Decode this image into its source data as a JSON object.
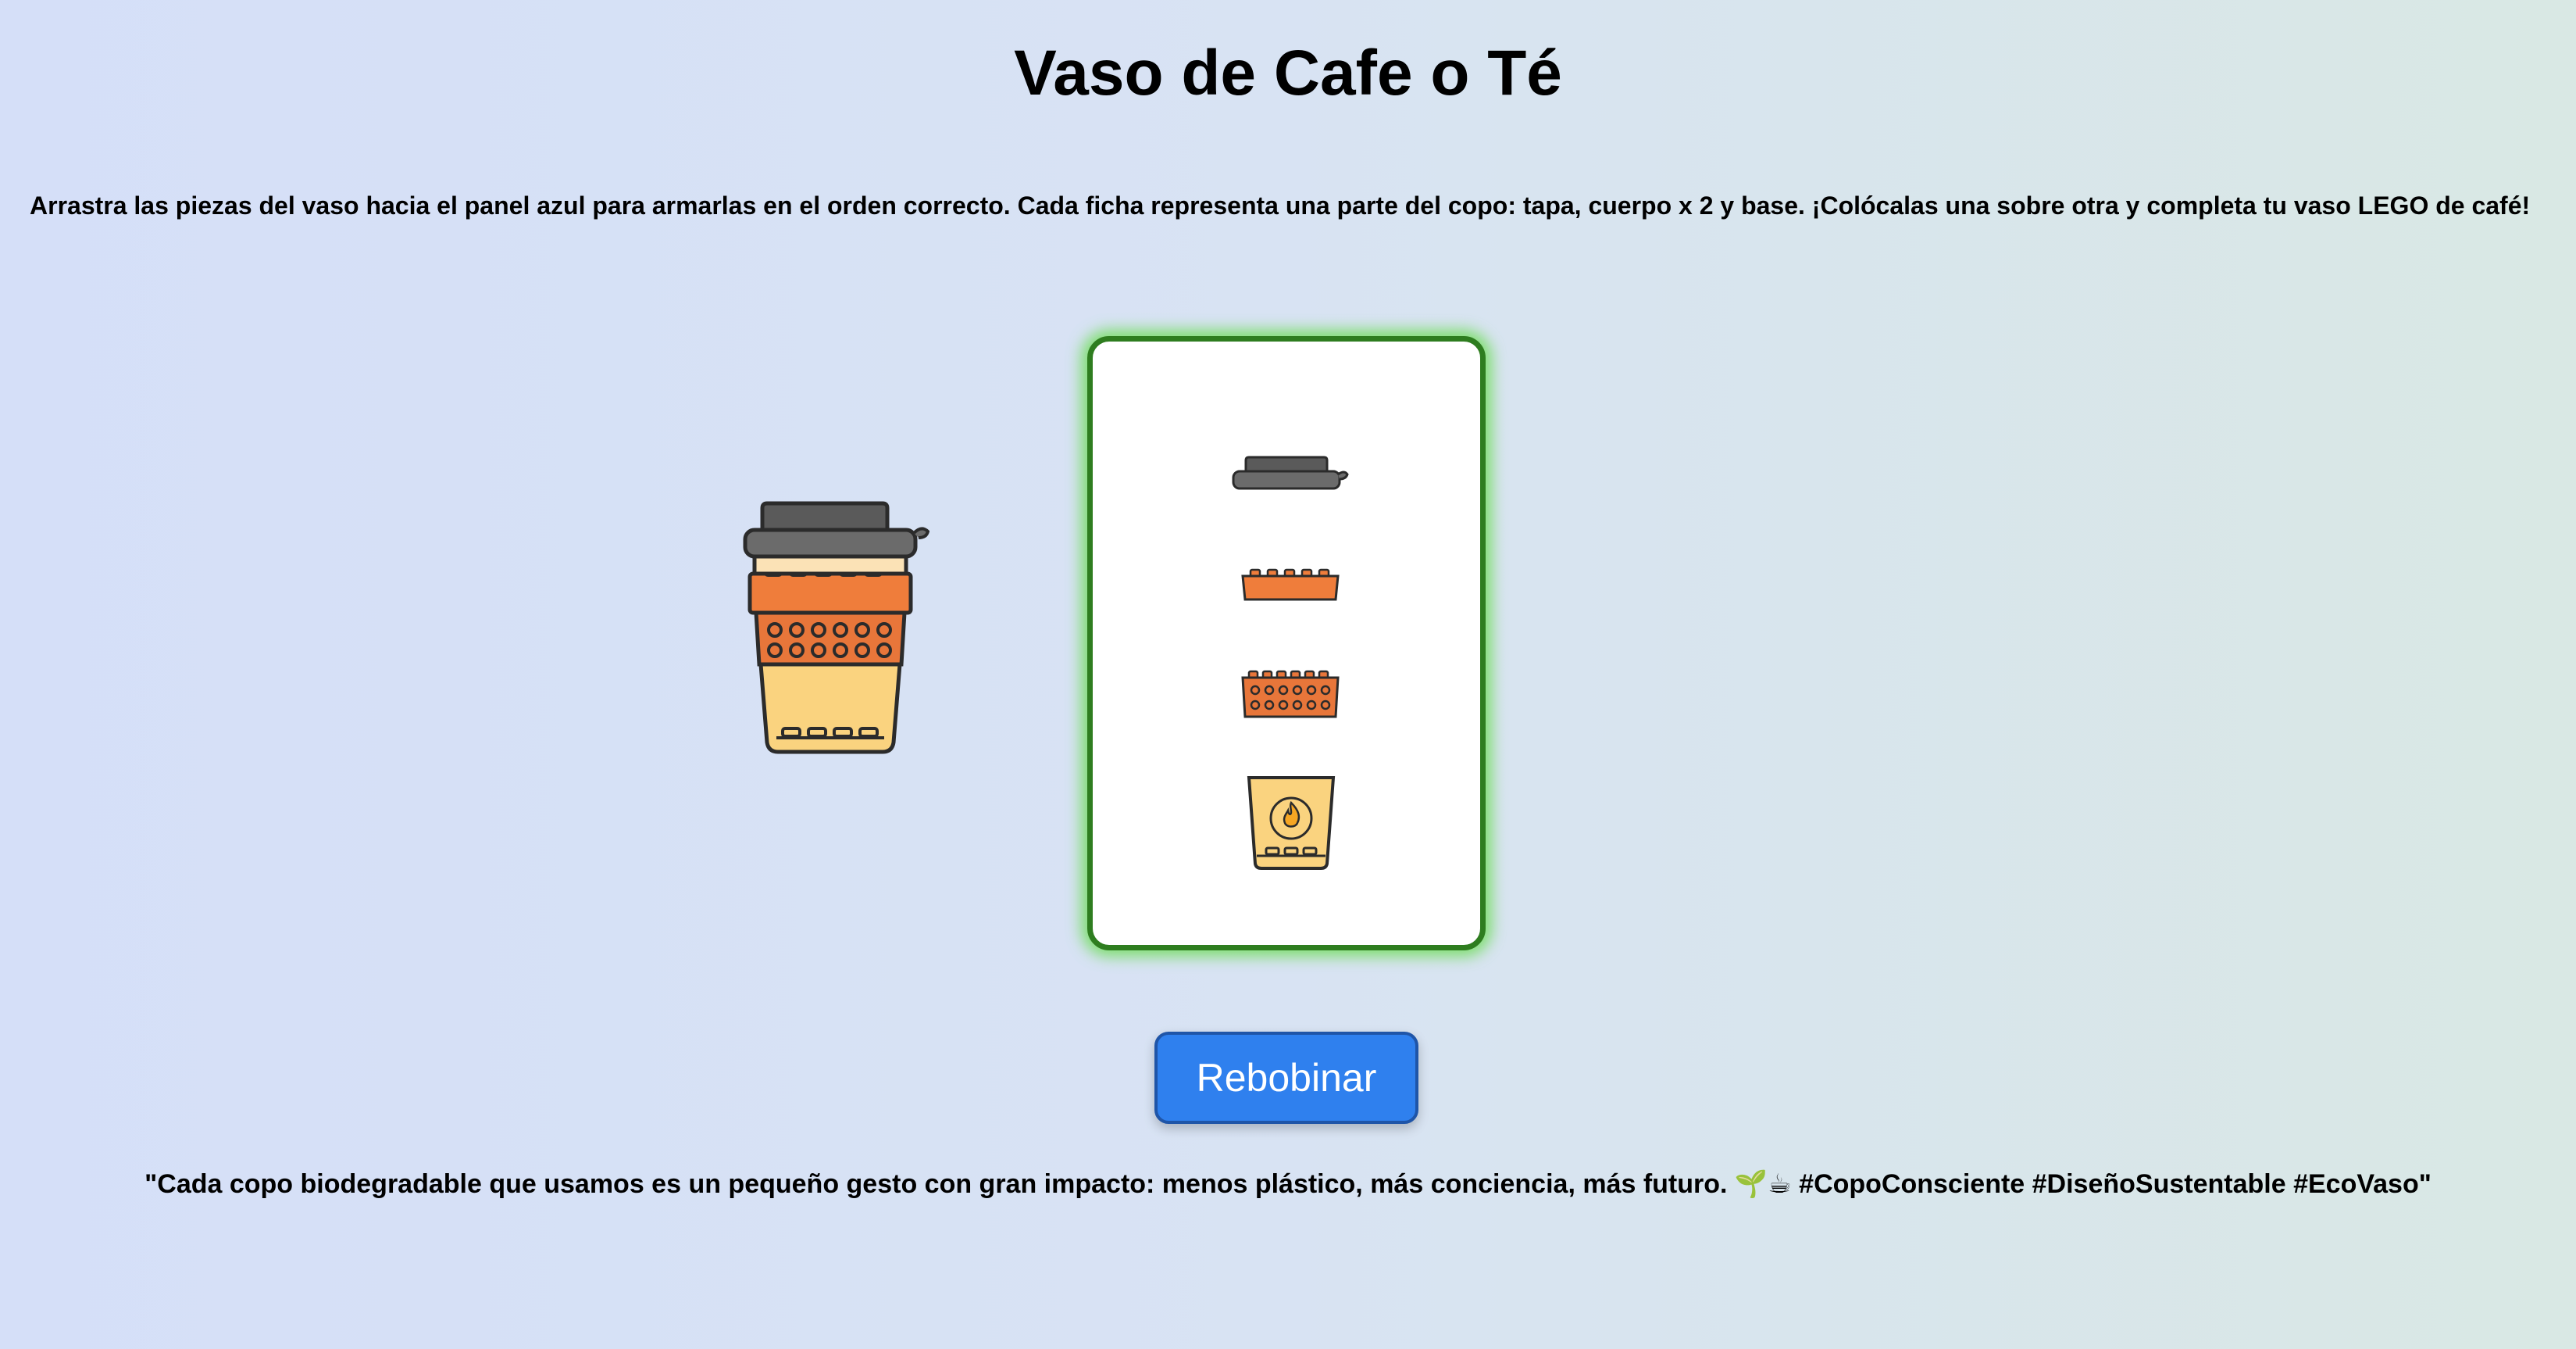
{
  "header": {
    "title": "Vaso de Cafe o Té"
  },
  "instructions": {
    "text": "Arrastra las piezas del vaso hacia el panel azul para armarlas en el orden correcto. Cada ficha representa una parte del copo: tapa, cuerpo x 2 y base. ¡Colócalas una sobre otra y completa tu vaso LEGO de café!"
  },
  "colors": {
    "lid": "#5a5a5a",
    "sleeve": "#ef7d3b",
    "body": "#e8763a",
    "cup": "#fad37f",
    "panel_border": "#2e7d1f",
    "button": "#2f80ee"
  },
  "pieces": [
    {
      "name": "lid",
      "icon": "cup-lid-icon"
    },
    {
      "name": "sleeve",
      "icon": "cup-sleeve-icon"
    },
    {
      "name": "body",
      "icon": "cup-body-icon"
    },
    {
      "name": "base",
      "icon": "cup-base-icon"
    }
  ],
  "actions": {
    "rewind_label": "Rebobinar"
  },
  "footer": {
    "quote": "\"Cada copo biodegradable que usamos es un pequeño gesto con gran impacto: menos plástico, más conciencia, más futuro. 🌱☕ #CopoConsciente #DiseñoSustentable #EcoVaso\""
  }
}
